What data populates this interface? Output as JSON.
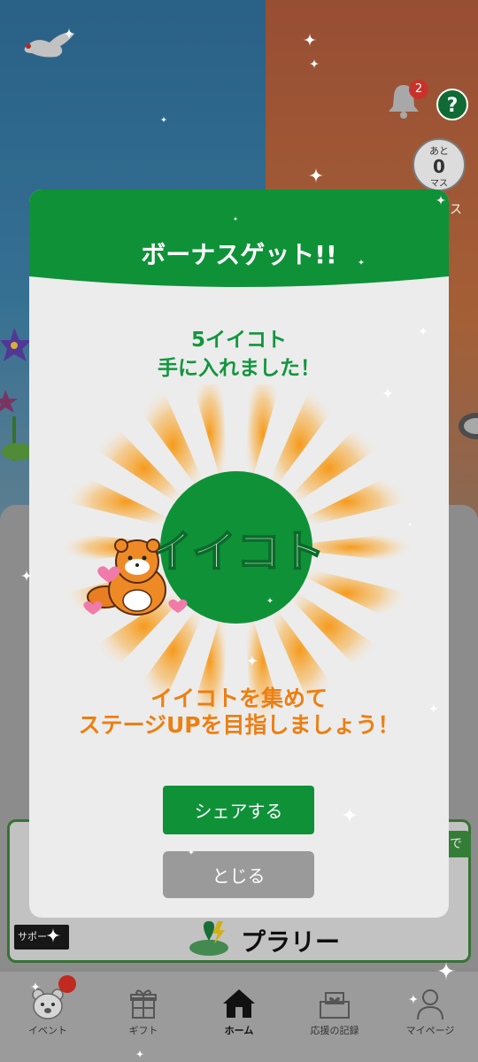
{
  "status": {
    "notification_count": "2",
    "help_label": "?",
    "remaining_top": "あと",
    "remaining_value": "0",
    "remaining_unit": "マス",
    "remaining_suffix": "ス"
  },
  "modal": {
    "title": "ボーナスゲット!!",
    "reward_line1": "5イイコト",
    "reward_line2": "手に入れました！",
    "coin_text": "イイコト",
    "cta_line1": "イイコトを集めて",
    "cta_line2": "ステージUPを目指しましょう！",
    "share_label": "シェアする",
    "close_label": "とじる"
  },
  "banner": {
    "tab_label": "で",
    "supporter_label": "サポー",
    "logo_text": "プラリー"
  },
  "nav": {
    "items": [
      {
        "label": "イベント",
        "icon": "bear-icon"
      },
      {
        "label": "ギフト",
        "icon": "gift-icon"
      },
      {
        "label": "ホーム",
        "icon": "home-icon"
      },
      {
        "label": "応援の記録",
        "icon": "record-box-icon"
      },
      {
        "label": "マイページ",
        "icon": "person-icon"
      }
    ],
    "active": "ホーム"
  },
  "colors": {
    "accent_green": "#0f9138",
    "cta_orange": "#ec7f12",
    "badge_red": "#c7332a"
  }
}
